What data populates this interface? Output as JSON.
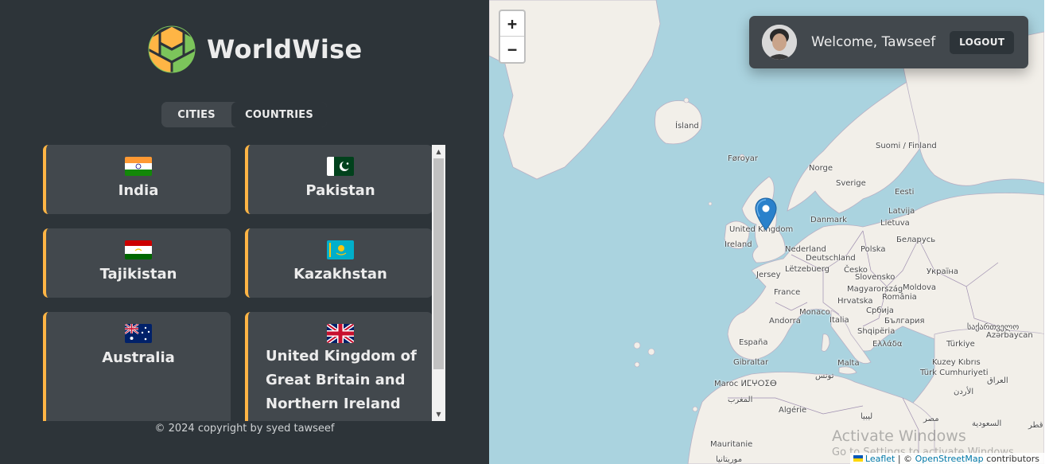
{
  "app": {
    "name": "WorldWise"
  },
  "tabs": [
    {
      "label": "CITIES"
    },
    {
      "label": "COUNTRIES"
    }
  ],
  "countries": [
    {
      "name": "India",
      "flag": "india-flag-icon"
    },
    {
      "name": "Pakistan",
      "flag": "pakistan-flag-icon"
    },
    {
      "name": "Tajikistan",
      "flag": "tajikistan-flag-icon"
    },
    {
      "name": "Kazakhstan",
      "flag": "kazakhstan-flag-icon"
    },
    {
      "name": "Australia",
      "flag": "australia-flag-icon"
    },
    {
      "name": "United Kingdom of Great Britain and Northern Ireland",
      "flag": "uk-flag-icon"
    }
  ],
  "footer": {
    "copyright": "© 2024 copyright by syed tawseef"
  },
  "map": {
    "zoom_in": "+",
    "zoom_out": "−",
    "labels": [
      "Ísland",
      "Føroyar",
      "Norge",
      "Sverige",
      "Suomi / Finland",
      "Eesti",
      "Latvija",
      "Lietuva",
      "Danmark",
      "United Kingdom",
      "Ireland",
      "Nederland",
      "Deutschland",
      "Polska",
      "Беларусь",
      "Україна",
      "Lëtzebuerg",
      "Česko",
      "Slovensko",
      "Jersey",
      "Magyarország",
      "Moldova",
      "France",
      "Hrvatska",
      "România",
      "Србија",
      "Andorra",
      "Monaco",
      "Italia",
      "България",
      "Shqipëria",
      "España",
      "Ελλάδα",
      "Türkiye",
      "საქართველო",
      "Azərbaycan",
      "Gibraltar",
      "Malta",
      "Kuzey Kıbrıs",
      "Türk Cumhuriyeti",
      "Maroc ⵍⵎⵖⵔⵉⴱ",
      "المغرب",
      "Algérie",
      "العراق",
      "الأردن",
      "ليبيا",
      "مصر",
      "السعودية",
      "قطر",
      "تونس",
      "Mauritanie",
      "موريتانيا"
    ],
    "user": {
      "welcome": "Welcome, Tawseef",
      "logout": "LOGOUT"
    },
    "attribution": {
      "leaflet": "Leaflet",
      "separator": "| ©",
      "osm": "OpenStreetMap",
      "contributors": "contributors"
    },
    "watermark": {
      "line1": "Activate Windows",
      "line2": "Go to Settings to activate Windows."
    }
  },
  "colors": {
    "sidebar_bg": "#2d3439",
    "card_bg": "#42484d",
    "accent": "#ffb545",
    "text": "#ececec",
    "sea": "#aad3df",
    "land": "#f2efe9",
    "marker": "#2a81cb"
  }
}
